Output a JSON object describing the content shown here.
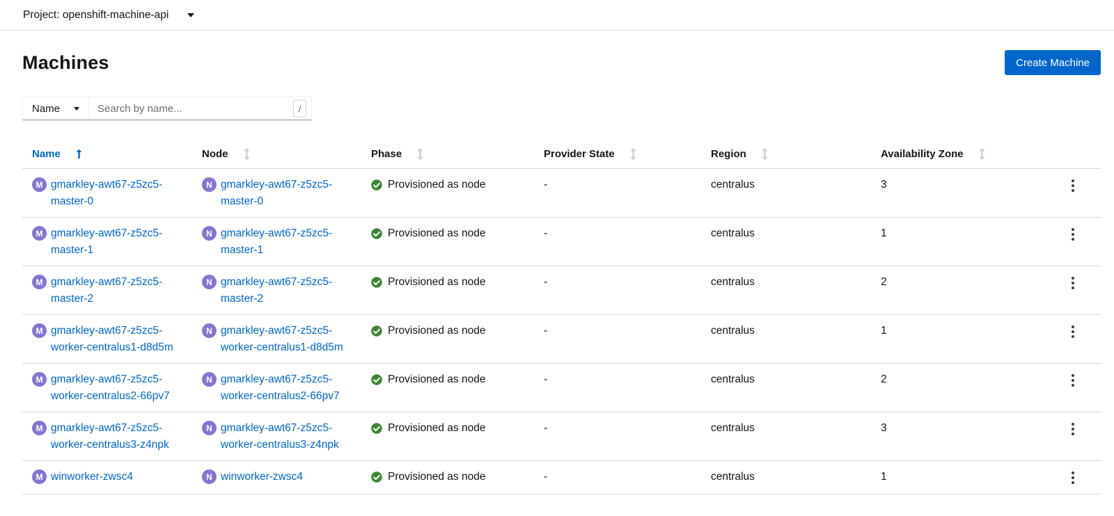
{
  "project_bar": {
    "label": "Project: openshift-machine-api"
  },
  "header": {
    "title": "Machines",
    "create_button_label": "Create Machine"
  },
  "toolbar": {
    "filter_dropdown_value": "Name",
    "search_placeholder": "Search by name...",
    "search_value": "",
    "shortcut_key": "/"
  },
  "table": {
    "columns": [
      {
        "label": "Name",
        "sorted": true,
        "sort_direction": "ascending"
      },
      {
        "label": "Node",
        "sorted": false
      },
      {
        "label": "Phase",
        "sorted": false
      },
      {
        "label": "Provider State",
        "sorted": false
      },
      {
        "label": "Region",
        "sorted": false
      },
      {
        "label": "Availability Zone",
        "sorted": false
      }
    ],
    "machine_badge_letter": "M",
    "node_badge_letter": "N",
    "rows": [
      {
        "machine": "gmarkley-awt67-z5zc5-master-0",
        "node": "gmarkley-awt67-z5zc5-master-0",
        "phase": "Provisioned as node",
        "provider_state": "-",
        "region": "centralus",
        "availability_zone": "3"
      },
      {
        "machine": "gmarkley-awt67-z5zc5-master-1",
        "node": "gmarkley-awt67-z5zc5-master-1",
        "phase": "Provisioned as node",
        "provider_state": "-",
        "region": "centralus",
        "availability_zone": "1"
      },
      {
        "machine": "gmarkley-awt67-z5zc5-master-2",
        "node": "gmarkley-awt67-z5zc5-master-2",
        "phase": "Provisioned as node",
        "provider_state": "-",
        "region": "centralus",
        "availability_zone": "2"
      },
      {
        "machine": "gmarkley-awt67-z5zc5-worker-centralus1-d8d5m",
        "node": "gmarkley-awt67-z5zc5-worker-centralus1-d8d5m",
        "phase": "Provisioned as node",
        "provider_state": "-",
        "region": "centralus",
        "availability_zone": "1"
      },
      {
        "machine": "gmarkley-awt67-z5zc5-worker-centralus2-66pv7",
        "node": "gmarkley-awt67-z5zc5-worker-centralus2-66pv7",
        "phase": "Provisioned as node",
        "provider_state": "-",
        "region": "centralus",
        "availability_zone": "2"
      },
      {
        "machine": "gmarkley-awt67-z5zc5-worker-centralus3-z4npk",
        "node": "gmarkley-awt67-z5zc5-worker-centralus3-z4npk",
        "phase": "Provisioned as node",
        "provider_state": "-",
        "region": "centralus",
        "availability_zone": "3"
      },
      {
        "machine": "winworker-zwsc4",
        "node": "winworker-zwsc4",
        "phase": "Provisioned as node",
        "provider_state": "-",
        "region": "centralus",
        "availability_zone": "1"
      }
    ]
  },
  "icons": {
    "project_caret": "caret-down-icon",
    "filter_caret": "caret-down-icon",
    "sorted_column": "long-arrow-up-icon",
    "unsorted_column": "arrows-up-down-icon",
    "phase_status": "check-circle-icon",
    "row_actions": "kebab-menu-icon"
  },
  "colors": {
    "accent_blue": "#0066cc",
    "link_blue": "#0066cc",
    "badge_purple": "#8476d1",
    "success_green": "#3e8635",
    "text_primary": "#151515",
    "text_muted": "#6a6e73",
    "border_gray": "#d7d7d7"
  }
}
